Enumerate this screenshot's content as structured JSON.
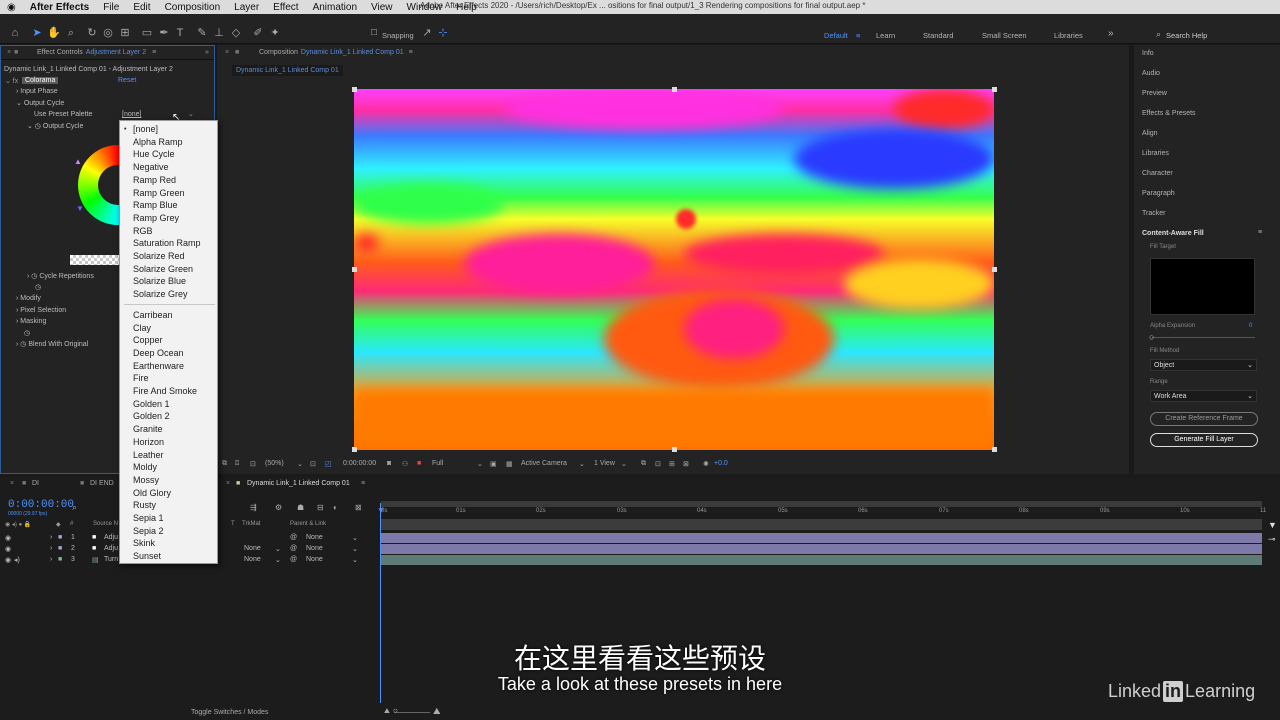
{
  "menubar": {
    "apple": "",
    "app": "After Effects",
    "items": [
      "File",
      "Edit",
      "Composition",
      "Layer",
      "Effect",
      "Animation",
      "View",
      "Window",
      "Help"
    ],
    "window_title": "Adobe After Effects 2020 - /Users/rich/Desktop/Ex ... ositions for final output/1_3 Rendering compositions for final output.aep *"
  },
  "toolbar": {
    "snapping": "Snapping",
    "workspaces": [
      "Default",
      "Learn",
      "Standard",
      "Small Screen",
      "Libraries"
    ],
    "search": "Search Help"
  },
  "effect_controls": {
    "tab_prefix": "Effect Controls",
    "tab_layer": "Adjustment Layer 2",
    "breadcrumb": "Dynamic Link_1 Linked Comp 01 - Adjustment Layer 2",
    "effect": "Colorama",
    "reset": "Reset",
    "input_phase": "Input Phase",
    "output_cycle": "Output Cycle",
    "use_preset": "Use Preset Palette",
    "preset_value": "[none]",
    "output_cycle_sub": "Output Cycle",
    "cycle_repetitions": "Cycle Repetitions",
    "modify": "Modify",
    "pixel_selection": "Pixel Selection",
    "masking": "Masking",
    "blend": "Blend With Original"
  },
  "dropdown": {
    "group1": [
      "[none]",
      "Alpha Ramp",
      "Hue Cycle",
      "Negative",
      "Ramp Red",
      "Ramp Green",
      "Ramp Blue",
      "Ramp Grey",
      "RGB",
      "Saturation Ramp",
      "Solarize Red",
      "Solarize Green",
      "Solarize Blue",
      "Solarize Grey"
    ],
    "group2": [
      "Carribean",
      "Clay",
      "Copper",
      "Deep Ocean",
      "Earthenware",
      "Fire",
      "Fire And Smoke",
      "Golden 1",
      "Golden 2",
      "Granite",
      "Horizon",
      "Leather",
      "Moldy",
      "Mossy",
      "Old Glory",
      "Rusty",
      "Sepia 1",
      "Sepia 2",
      "Skink",
      "Sunset"
    ]
  },
  "composition": {
    "tab_prefix": "Composition",
    "tab_name": "Dynamic Link_1 Linked Comp 01",
    "sub_tab": "Dynamic Link_1 Linked Comp 01",
    "zoom": "(50%)",
    "time": "0:00:00:00",
    "resolution": "Full",
    "camera": "Active Camera",
    "views": "1 View",
    "exposure": "+0.0"
  },
  "right_panel": {
    "items": [
      "Info",
      "Audio",
      "Preview",
      "Effects & Presets",
      "Align",
      "Libraries",
      "Character",
      "Paragraph",
      "Tracker"
    ],
    "caf_title": "Content-Aware Fill",
    "fill_target": "Fill Target",
    "alpha_expansion": "Alpha Expansion",
    "alpha_value": "0",
    "fill_method": "Fill Method",
    "fill_method_value": "Object",
    "range": "Range",
    "range_value": "Work Area",
    "create_ref": "Create Reference Frame",
    "generate": "Generate Fill Layer"
  },
  "timeline": {
    "tabs": [
      "DI",
      "DI END"
    ],
    "comp_tab": "Dynamic Link_1 Linked Comp 01",
    "timecode": "0:00:00:00",
    "timecode_sub": "00000 (29.97 fps)",
    "col_num": "#",
    "col_source": "Source N",
    "col_trkmat": "TrkMat",
    "col_parent": "Parent & Link",
    "col_t": "T",
    "rows": [
      {
        "num": "1",
        "name": "Adju",
        "trkmat": "",
        "parent": "None"
      },
      {
        "num": "2",
        "name": "Adju",
        "trkmat": "None",
        "parent": "None"
      },
      {
        "num": "3",
        "name": "Turn",
        "trkmat": "None",
        "parent": "None"
      }
    ],
    "ruler": [
      "0s",
      "01s",
      "02s",
      "03s",
      "04s",
      "05s",
      "06s",
      "07s",
      "08s",
      "09s",
      "10s",
      "11"
    ],
    "toggle": "Toggle Switches / Modes"
  },
  "subtitles": {
    "cn": "在这里看看这些预设",
    "en": "Take a look at these presets in here"
  },
  "brand": {
    "linked": "Linked",
    "in": "in",
    "learning": "Learning"
  }
}
